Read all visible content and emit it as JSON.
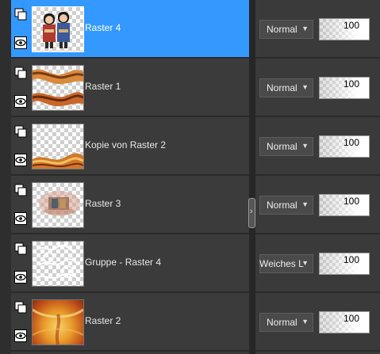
{
  "layers": [
    {
      "name": "Raster 4",
      "selected": true,
      "blend_mode": "Normal",
      "opacity": "100",
      "thumbnail": "dolls-figures"
    },
    {
      "name": "Raster 1",
      "selected": false,
      "blend_mode": "Normal",
      "opacity": "100",
      "thumbnail": "orange-waves"
    },
    {
      "name": "Kopie von Raster 2",
      "selected": false,
      "blend_mode": "Normal",
      "opacity": "100",
      "thumbnail": "orange-bottom-wave"
    },
    {
      "name": "Raster 3",
      "selected": false,
      "blend_mode": "Normal",
      "opacity": "100",
      "thumbnail": "decor-blur"
    },
    {
      "name": "Gruppe - Raster 4",
      "selected": false,
      "blend_mode": "Weiches Licht",
      "opacity": "100",
      "thumbnail": "white-sketch"
    },
    {
      "name": "Raster 2",
      "selected": false,
      "blend_mode": "Normal",
      "opacity": "100",
      "thumbnail": "orange-texture"
    }
  ],
  "icons": {
    "copy": "layer-copy-icon",
    "visibility": "eye-icon",
    "expand": "chevron-right-icon",
    "dropdown": "chevron-down-icon"
  },
  "colors": {
    "selected_row": "#3399ff",
    "panel_bg": "#3b3b3b",
    "divider": "#262626"
  }
}
